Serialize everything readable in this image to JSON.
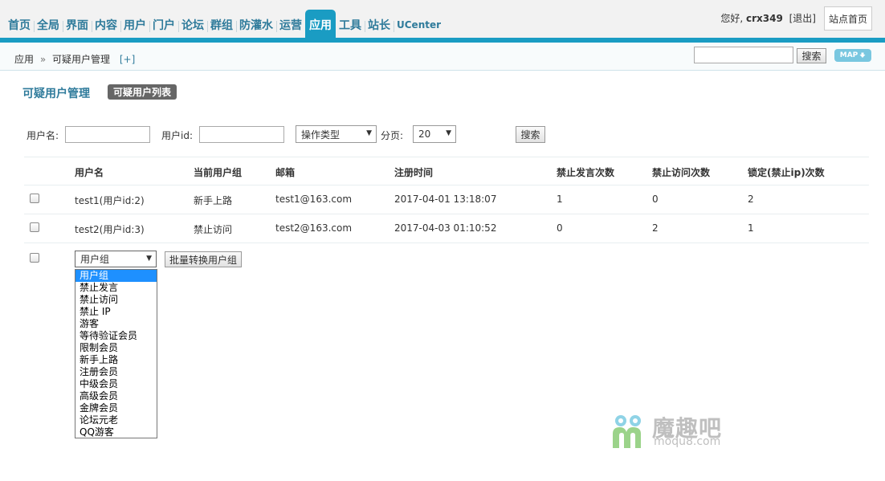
{
  "nav": {
    "items": [
      "首页",
      "全局",
      "界面",
      "内容",
      "用户",
      "门户",
      "论坛",
      "群组",
      "防灌水",
      "运营",
      "应用",
      "工具",
      "站长",
      "UCenter"
    ],
    "active": "应用"
  },
  "user": {
    "greeting": "您好,",
    "name": "crx349",
    "logout": "[退出]"
  },
  "site_home": "站点首页",
  "breadcrumb": {
    "root": "应用",
    "sep": "»",
    "current": "可疑用户管理",
    "add": "[+]"
  },
  "top_search": {
    "value": "",
    "button": "搜索"
  },
  "map_button": "MAP",
  "page": {
    "title": "可疑用户管理",
    "tab": "可疑用户列表"
  },
  "filters": {
    "username_label": "用户名:",
    "userid_label": "用户id:",
    "op_type": "操作类型",
    "paging_label": "分页:",
    "page_size": "20",
    "search_button": "搜索"
  },
  "table": {
    "headers": [
      "用户名",
      "当前用户组",
      "邮箱",
      "注册时间",
      "禁止发言次数",
      "禁止访问次数",
      "锁定(禁止ip)次数"
    ],
    "rows": [
      [
        "test1(用户id:2)",
        "新手上路",
        "test1@163.com",
        "2017-04-01 13:18:07",
        "1",
        "0",
        "2"
      ],
      [
        "test2(用户id:3)",
        "禁止访问",
        "test2@163.com",
        "2017-04-03 01:10:52",
        "0",
        "2",
        "1"
      ]
    ]
  },
  "batch": {
    "select_value": "用户组",
    "button": "批量转换用户组",
    "options": [
      "用户组",
      "禁止发言",
      "禁止访问",
      "禁止 IP",
      "游客",
      "等待验证会员",
      "限制会员",
      "新手上路",
      "注册会员",
      "中级会员",
      "高级会员",
      "金牌会员",
      "论坛元老",
      "QQ游客"
    ]
  },
  "watermark": {
    "cn": "魔趣吧",
    "en": "moqu8.com"
  },
  "colors": {
    "accent": "#1a9cc3",
    "nav_text": "#2f7b9b",
    "selected_option": "#1e90ff"
  }
}
